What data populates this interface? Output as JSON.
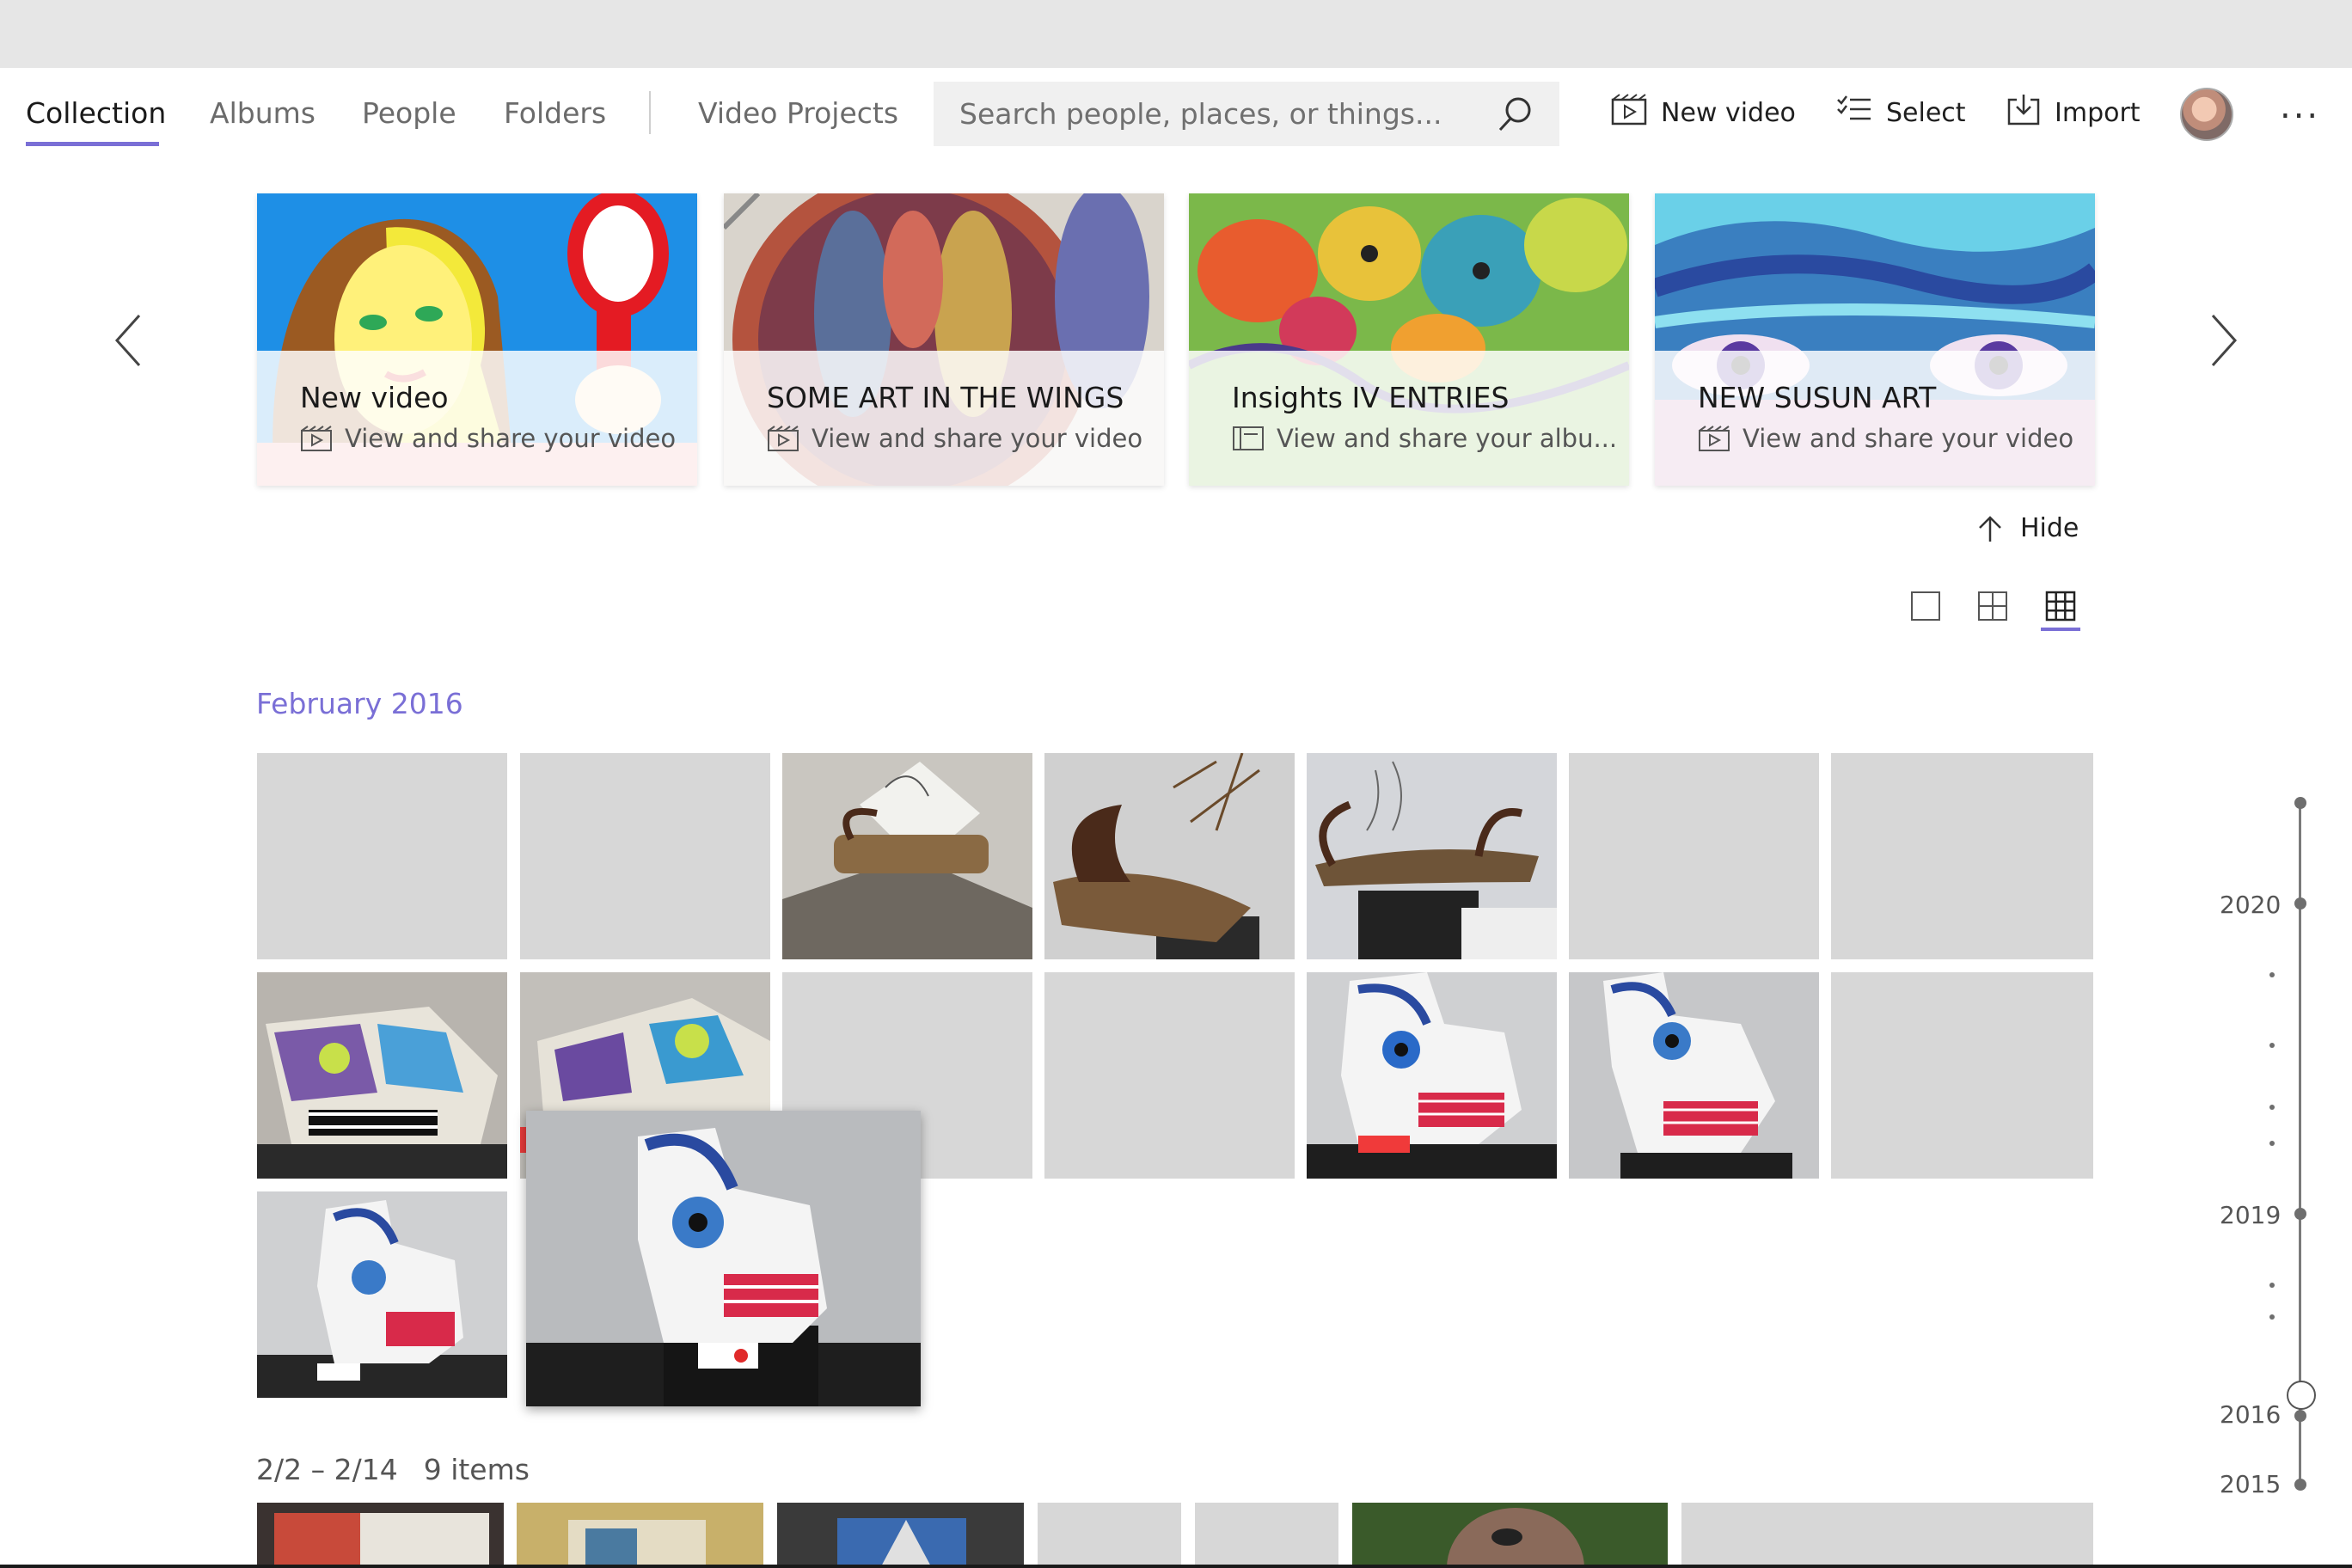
{
  "nav": {
    "tabs": [
      {
        "label": "Collection",
        "active": true
      },
      {
        "label": "Albums"
      },
      {
        "label": "People"
      },
      {
        "label": "Folders"
      },
      {
        "label": "Video Projects"
      }
    ],
    "search_placeholder": "Search people, places, or things...",
    "new_video": "New video",
    "select": "Select",
    "import": "Import",
    "more": "..."
  },
  "cards": [
    {
      "title": "New video",
      "subtitle": "View and share your video",
      "kind": "video"
    },
    {
      "title": "SOME ART IN THE WINGS",
      "subtitle": "View and share your video",
      "kind": "video"
    },
    {
      "title": "Insights IV ENTRIES",
      "subtitle": "View and share your albu...",
      "kind": "album"
    },
    {
      "title": "NEW SUSUN ART",
      "subtitle": "View and share your video",
      "kind": "video"
    }
  ],
  "hide_label": "Hide",
  "month_label": "February 2016",
  "range": {
    "dates": "2/2 – 2/14",
    "count": "9 items"
  },
  "timeline": {
    "years": [
      "2020",
      "2019",
      "2016",
      "2015"
    ]
  },
  "colors": {
    "accent": "#7a6fd6",
    "placeholder_tile": "#d7d7d7",
    "titlebar": "#e6e6e6"
  }
}
